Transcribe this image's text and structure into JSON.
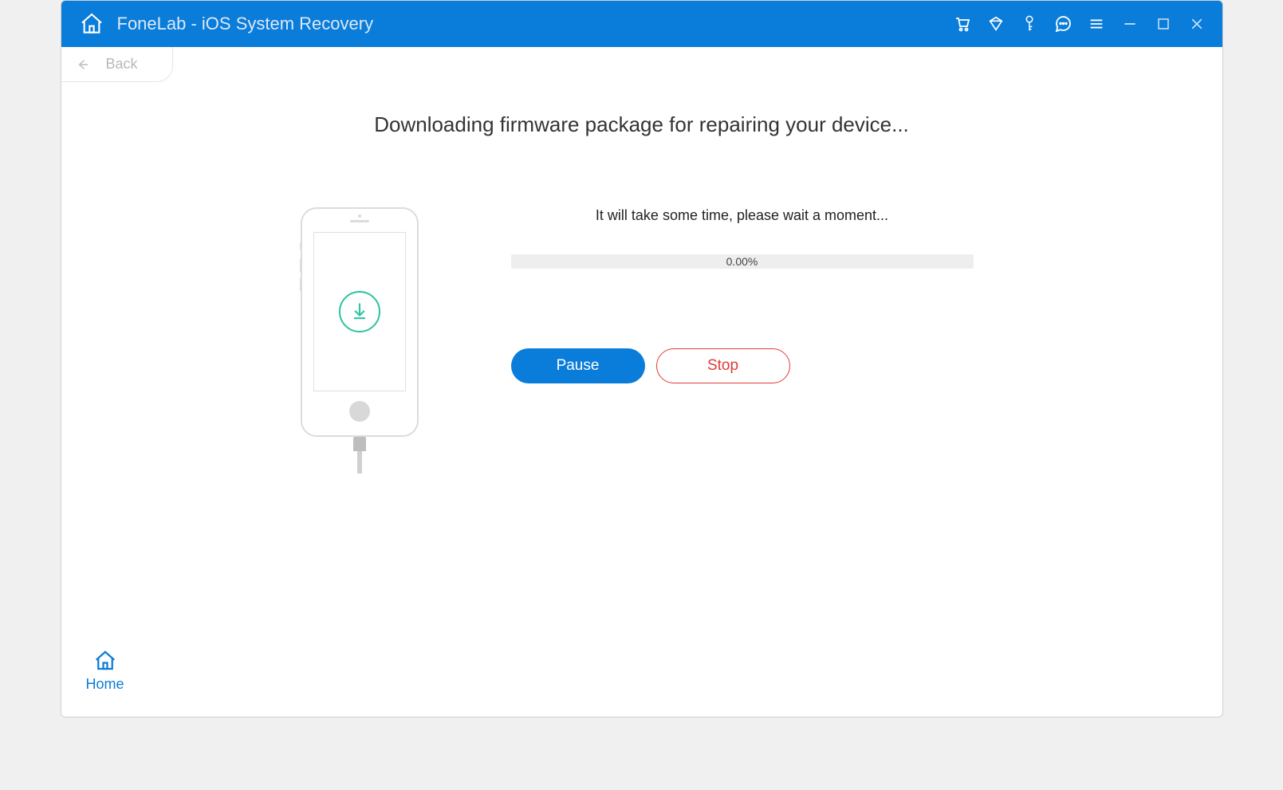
{
  "titlebar": {
    "title": "FoneLab - iOS System Recovery"
  },
  "back": {
    "label": "Back"
  },
  "heading": "Downloading firmware package for repairing your device...",
  "subtext": "It will take some time, please wait a moment...",
  "progress": {
    "percent_text": "0.00%"
  },
  "buttons": {
    "pause": "Pause",
    "stop": "Stop"
  },
  "home": {
    "label": "Home"
  }
}
